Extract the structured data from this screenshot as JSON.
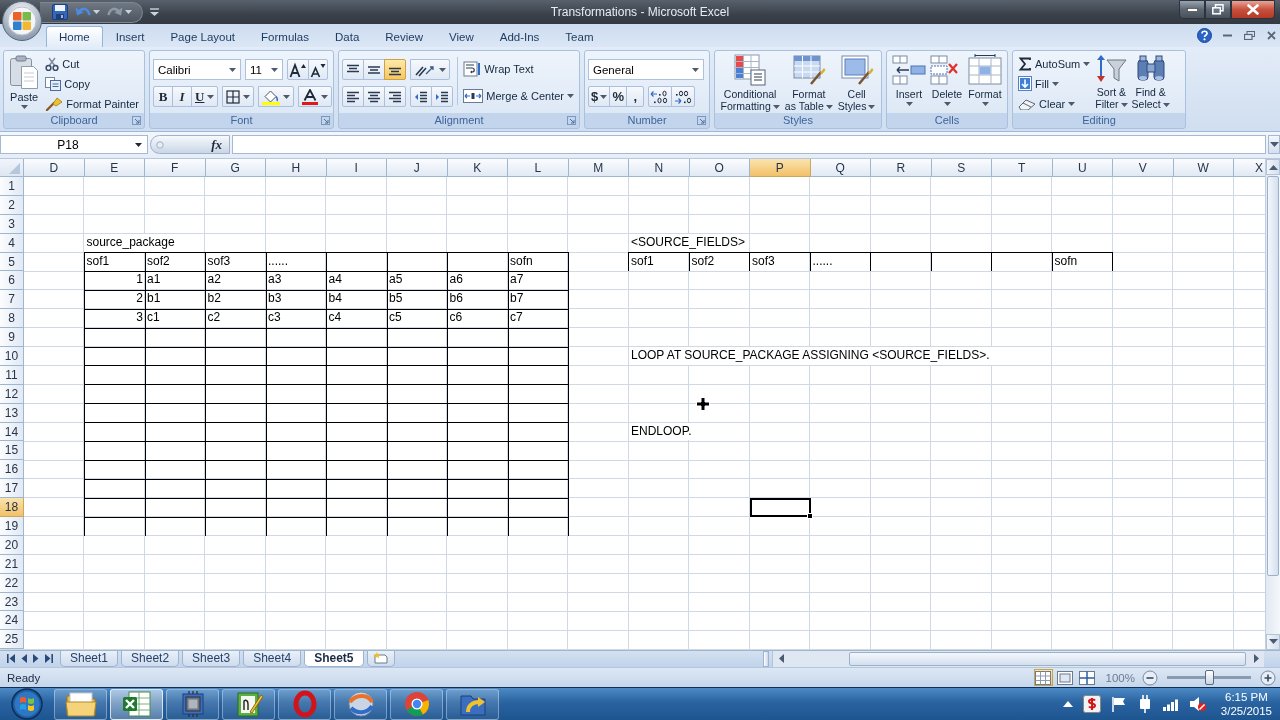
{
  "window": {
    "title": "Transformations - Microsoft Excel"
  },
  "ribbon_tabs": [
    {
      "label": "Home",
      "selected": true
    },
    {
      "label": "Insert",
      "selected": false
    },
    {
      "label": "Page Layout",
      "selected": false
    },
    {
      "label": "Formulas",
      "selected": false
    },
    {
      "label": "Data",
      "selected": false
    },
    {
      "label": "Review",
      "selected": false
    },
    {
      "label": "View",
      "selected": false
    },
    {
      "label": "Add-Ins",
      "selected": false
    },
    {
      "label": "Team",
      "selected": false
    }
  ],
  "ribbon_groups": [
    {
      "kind": "clipboard",
      "label": "Clipboard",
      "launcher": true,
      "paste": "Paste",
      "buttons": [
        {
          "kind": "cut",
          "label": "Cut"
        },
        {
          "kind": "copy",
          "label": "Copy"
        },
        {
          "kind": "painter",
          "label": "Format Painter"
        }
      ]
    },
    {
      "kind": "font",
      "label": "Font",
      "launcher": true,
      "font_name": "Calibri",
      "font_size": "11",
      "style_buttons": [
        {
          "kind": "bold",
          "label": "B"
        },
        {
          "kind": "italic",
          "label": "I"
        },
        {
          "kind": "underline",
          "label": "U"
        }
      ]
    },
    {
      "kind": "alignment",
      "label": "Alignment",
      "launcher": true,
      "vertical_align": [
        {
          "kind": "top",
          "selected": false
        },
        {
          "kind": "middle",
          "selected": false
        },
        {
          "kind": "bottom",
          "selected": true
        }
      ],
      "wrap_text": "Wrap Text",
      "merge": "Merge & Center"
    },
    {
      "kind": "number",
      "label": "Number",
      "launcher": true,
      "format": "General",
      "symbol_buttons": [
        {
          "kind": "currency",
          "label": "$"
        },
        {
          "kind": "percent",
          "label": "%"
        },
        {
          "kind": "comma",
          "label": ","
        }
      ]
    },
    {
      "kind": "styles",
      "label": "Styles",
      "launcher": false,
      "buttons": [
        {
          "kind": "conditional",
          "lines": [
            "Conditional",
            "Formatting"
          ]
        },
        {
          "kind": "table",
          "lines": [
            "Format",
            "as Table"
          ]
        },
        {
          "kind": "cellstyle",
          "lines": [
            "Cell",
            "Styles"
          ]
        }
      ]
    },
    {
      "kind": "cells",
      "label": "Cells",
      "launcher": false,
      "buttons": [
        {
          "kind": "insert",
          "label": "Insert"
        },
        {
          "kind": "delete",
          "label": "Delete"
        },
        {
          "kind": "format",
          "label": "Format"
        }
      ]
    },
    {
      "kind": "editing",
      "label": "Editing",
      "launcher": false,
      "small_buttons": [
        {
          "kind": "sum",
          "label": "AutoSum"
        },
        {
          "kind": "fill",
          "label": "Fill"
        },
        {
          "kind": "clear",
          "label": "Clear"
        }
      ],
      "buttons": [
        {
          "kind": "sort",
          "lines": [
            "Sort &",
            "Filter"
          ]
        },
        {
          "kind": "find",
          "lines": [
            "Find &",
            "Select"
          ]
        }
      ]
    }
  ],
  "formula_bar": {
    "name_box": "P18",
    "function_button": "fx"
  },
  "sheet": {
    "columns": [
      {
        "label": "D",
        "selected": false
      },
      {
        "label": "E",
        "selected": false
      },
      {
        "label": "F",
        "selected": false
      },
      {
        "label": "G",
        "selected": false
      },
      {
        "label": "H",
        "selected": false
      },
      {
        "label": "I",
        "selected": false
      },
      {
        "label": "J",
        "selected": false
      },
      {
        "label": "K",
        "selected": false
      },
      {
        "label": "L",
        "selected": false
      },
      {
        "label": "M",
        "selected": false
      },
      {
        "label": "N",
        "selected": false
      },
      {
        "label": "O",
        "selected": false
      },
      {
        "label": "P",
        "selected": true
      },
      {
        "label": "Q",
        "selected": false
      },
      {
        "label": "R",
        "selected": false
      },
      {
        "label": "S",
        "selected": false
      },
      {
        "label": "T",
        "selected": false
      },
      {
        "label": "U",
        "selected": false
      },
      {
        "label": "V",
        "selected": false
      },
      {
        "label": "W",
        "selected": false
      },
      {
        "label": "X",
        "selected": false
      }
    ],
    "rows": [
      {
        "label": "1",
        "selected": false
      },
      {
        "label": "2",
        "selected": false
      },
      {
        "label": "3",
        "selected": false
      },
      {
        "label": "4",
        "selected": false
      },
      {
        "label": "5",
        "selected": false
      },
      {
        "label": "6",
        "selected": false
      },
      {
        "label": "7",
        "selected": false
      },
      {
        "label": "8",
        "selected": false
      },
      {
        "label": "9",
        "selected": false
      },
      {
        "label": "10",
        "selected": false
      },
      {
        "label": "11",
        "selected": false
      },
      {
        "label": "12",
        "selected": false
      },
      {
        "label": "13",
        "selected": false
      },
      {
        "label": "14",
        "selected": false
      },
      {
        "label": "15",
        "selected": false
      },
      {
        "label": "16",
        "selected": false
      },
      {
        "label": "17",
        "selected": false
      },
      {
        "label": "18",
        "selected": true
      },
      {
        "label": "19",
        "selected": false
      },
      {
        "label": "20",
        "selected": false
      },
      {
        "label": "21",
        "selected": false
      },
      {
        "label": "22",
        "selected": false
      },
      {
        "label": "23",
        "selected": false
      },
      {
        "label": "24",
        "selected": false
      },
      {
        "label": "25",
        "selected": false
      }
    ],
    "cell_texts": [
      {
        "text": "source_package"
      },
      {
        "text": "<SOURCE_FIELDS>"
      },
      {
        "text": "LOOP AT SOURCE_PACKAGE ASSIGNING <SOURCE_FIELDS>."
      },
      {
        "text": "ENDLOOP."
      }
    ],
    "tables": [
      {
        "rows": [
          [
            {
              "kind": "text",
              "text": "sof1"
            },
            {
              "kind": "text",
              "text": "sof2"
            },
            {
              "kind": "text",
              "text": "sof3"
            },
            {
              "kind": "text",
              "text": "......"
            },
            null,
            null,
            null,
            {
              "kind": "text",
              "text": "sofn"
            }
          ],
          [
            {
              "kind": "number",
              "text": "1"
            },
            {
              "kind": "text",
              "text": "a1"
            },
            {
              "kind": "text",
              "text": "a2"
            },
            {
              "kind": "text",
              "text": "a3"
            },
            {
              "kind": "text",
              "text": "a4"
            },
            {
              "kind": "text",
              "text": "a5"
            },
            {
              "kind": "text",
              "text": "a6"
            },
            {
              "kind": "text",
              "text": "a7"
            }
          ],
          [
            {
              "kind": "number",
              "text": "2"
            },
            {
              "kind": "text",
              "text": "b1"
            },
            {
              "kind": "text",
              "text": "b2"
            },
            {
              "kind": "text",
              "text": "b3"
            },
            {
              "kind": "text",
              "text": "b4"
            },
            {
              "kind": "text",
              "text": "b5"
            },
            {
              "kind": "text",
              "text": "b6"
            },
            {
              "kind": "text",
              "text": "b7"
            }
          ],
          [
            {
              "kind": "number",
              "text": "3"
            },
            {
              "kind": "text",
              "text": "c1"
            },
            {
              "kind": "text",
              "text": "c2"
            },
            {
              "kind": "text",
              "text": "c3"
            },
            {
              "kind": "text",
              "text": "c4"
            },
            {
              "kind": "text",
              "text": "c5"
            },
            {
              "kind": "text",
              "text": "c6"
            },
            {
              "kind": "text",
              "text": "c7"
            }
          ],
          [
            null,
            null,
            null,
            null,
            null,
            null,
            null,
            null
          ],
          [
            null,
            null,
            null,
            null,
            null,
            null,
            null,
            null
          ],
          [
            null,
            null,
            null,
            null,
            null,
            null,
            null,
            null
          ],
          [
            null,
            null,
            null,
            null,
            null,
            null,
            null,
            null
          ],
          [
            null,
            null,
            null,
            null,
            null,
            null,
            null,
            null
          ],
          [
            null,
            null,
            null,
            null,
            null,
            null,
            null,
            null
          ],
          [
            null,
            null,
            null,
            null,
            null,
            null,
            null,
            null
          ],
          [
            null,
            null,
            null,
            null,
            null,
            null,
            null,
            null
          ],
          [
            null,
            null,
            null,
            null,
            null,
            null,
            null,
            null
          ],
          [
            null,
            null,
            null,
            null,
            null,
            null,
            null,
            null
          ],
          [
            null,
            null,
            null,
            null,
            null,
            null,
            null,
            null
          ]
        ]
      },
      {
        "rows": [
          [
            {
              "kind": "text",
              "text": "sof1"
            },
            {
              "kind": "text",
              "text": "sof2"
            },
            {
              "kind": "text",
              "text": "sof3"
            },
            {
              "kind": "text",
              "text": "......"
            },
            null,
            null,
            null,
            {
              "kind": "text",
              "text": "sofn"
            }
          ]
        ]
      }
    ]
  },
  "sheet_tabs": [
    {
      "label": "Sheet1",
      "selected": false
    },
    {
      "label": "Sheet2",
      "selected": false
    },
    {
      "label": "Sheet3",
      "selected": false
    },
    {
      "label": "Sheet4",
      "selected": false
    },
    {
      "label": "Sheet5",
      "selected": true
    }
  ],
  "status_bar": {
    "text": "Ready",
    "view_buttons": [
      {
        "kind": "normal",
        "selected": true
      },
      {
        "kind": "layout",
        "selected": false
      },
      {
        "kind": "pagebreak",
        "selected": false
      }
    ],
    "zoom": "100%",
    "zoom_slider": {
      "level": 0.5
    }
  },
  "taskbar": {
    "apps": [
      {
        "kind": "folder",
        "active": false
      },
      {
        "kind": "spreadsheet",
        "active": true
      },
      {
        "kind": "chip",
        "active": false
      },
      {
        "kind": "editor",
        "active": false
      },
      {
        "kind": "ring",
        "active": false
      },
      {
        "kind": "sphere",
        "active": false
      },
      {
        "kind": "tricolor",
        "active": false
      },
      {
        "kind": "sync",
        "active": false
      }
    ],
    "time": "6:15 PM",
    "date": "3/25/2015"
  }
}
